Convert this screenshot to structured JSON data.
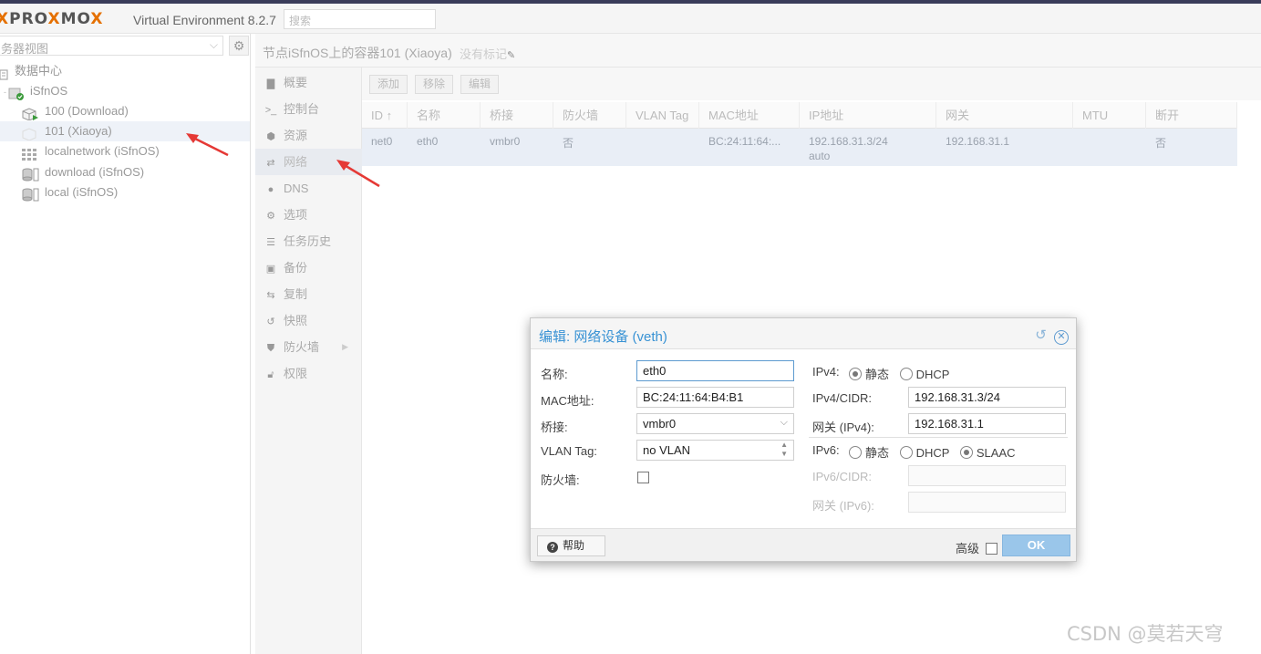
{
  "topbar": {
    "logo_left": "X",
    "logo_pro": "PRO",
    "logo_x": "X",
    "logo_mo": "MO",
    "logo_x2": "X",
    "version": "Virtual Environment 8.2.7",
    "search_placeholder": "搜索"
  },
  "tree": {
    "view_label": "务器视图",
    "items": [
      {
        "label": "数据中心",
        "icon": "datacenter-icon"
      },
      {
        "label": "iSfnOS",
        "icon": "node-online-icon"
      },
      {
        "label": "100 (Download)",
        "icon": "container-running-icon"
      },
      {
        "label": "101 (Xiaoya)",
        "icon": "container-icon"
      },
      {
        "label": "localnetwork (iSfnOS)",
        "icon": "sdn-grid-icon"
      },
      {
        "label": "download (iSfnOS)",
        "icon": "storage-icon"
      },
      {
        "label": "local (iSfnOS)",
        "icon": "storage-icon"
      }
    ]
  },
  "header": {
    "breadcrumb": "节点iSfnOS上的容器101 (Xiaoya)",
    "tags": "没有标记"
  },
  "nav": {
    "items": [
      {
        "label": "概要",
        "icon": "book-icon"
      },
      {
        "label": "控制台",
        "icon": "terminal-icon"
      },
      {
        "label": "资源",
        "icon": "cube-icon"
      },
      {
        "label": "网络",
        "icon": "exchange-icon"
      },
      {
        "label": "DNS",
        "icon": "globe-icon"
      },
      {
        "label": "选项",
        "icon": "gear-icon"
      },
      {
        "label": "任务历史",
        "icon": "list-icon"
      },
      {
        "label": "备份",
        "icon": "floppy-icon"
      },
      {
        "label": "复制",
        "icon": "retweet-icon"
      },
      {
        "label": "快照",
        "icon": "history-icon"
      },
      {
        "label": "防火墙",
        "icon": "shield-icon"
      },
      {
        "label": "权限",
        "icon": "unlock-icon"
      }
    ]
  },
  "toolbar": {
    "add": "添加",
    "remove": "移除",
    "edit": "编辑"
  },
  "grid": {
    "columns": [
      "ID ↑",
      "名称",
      "桥接",
      "防火墙",
      "VLAN Tag",
      "MAC地址",
      "IP地址",
      "网关",
      "MTU",
      "断开"
    ],
    "row": {
      "id": "net0",
      "name": "eth0",
      "bridge": "vmbr0",
      "firewall": "否",
      "vlan": "",
      "mac": "BC:24:11:64:...",
      "ip": "192.168.31.3/24",
      "ip_sub": "auto",
      "gateway": "192.168.31.1",
      "mtu": "",
      "disconnect": "否"
    }
  },
  "dialog": {
    "title": "编辑: 网络设备 (veth)",
    "name_label": "名称:",
    "name_value": "eth0",
    "mac_label": "MAC地址:",
    "mac_value": "BC:24:11:64:B4:B1",
    "bridge_label": "桥接:",
    "bridge_value": "vmbr0",
    "vlan_label": "VLAN Tag:",
    "vlan_value": "no VLAN",
    "firewall_label": "防火墙:",
    "ipv4_label": "IPv4:",
    "ipv4_static": "静态",
    "ipv4_dhcp": "DHCP",
    "ipv4_cidr_label": "IPv4/CIDR:",
    "ipv4_cidr_value": "192.168.31.3/24",
    "gw4_label": "网关 (IPv4):",
    "gw4_value": "192.168.31.1",
    "ipv6_label": "IPv6:",
    "ipv6_static": "静态",
    "ipv6_dhcp": "DHCP",
    "ipv6_slaac": "SLAAC",
    "ipv6_cidr_label": "IPv6/CIDR:",
    "gw6_label": "网关 (IPv6):",
    "help": "帮助",
    "advanced": "高级",
    "ok": "OK"
  },
  "watermark": "CSDN @莫若天穹",
  "colors": {
    "accent": "#3892d4",
    "ok_button": "#9ac6ea",
    "logo_x": "#e57000",
    "arrow": "#e53935"
  }
}
